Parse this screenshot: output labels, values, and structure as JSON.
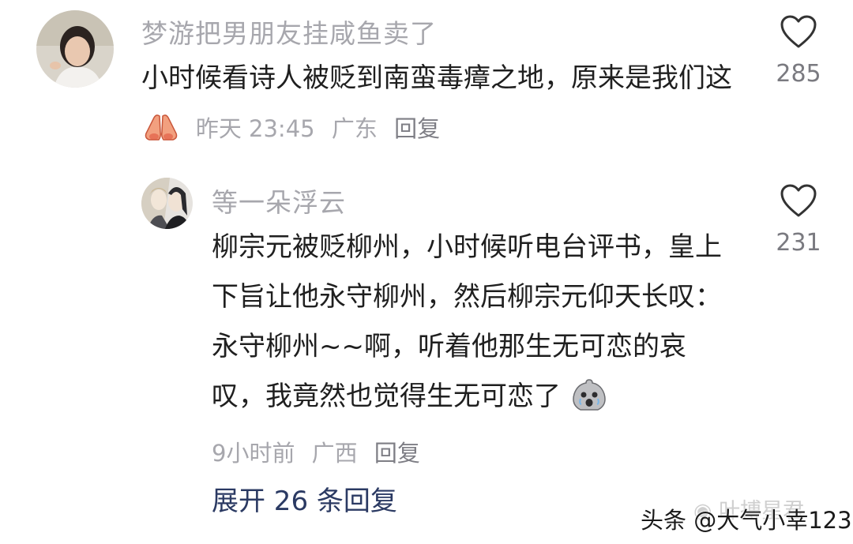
{
  "comments": [
    {
      "username": "梦游把男朋友挂咸鱼卖了",
      "text": "小时候看诗人被贬到南蛮毒瘴之地，原来是我们这",
      "emoji": "praying-hands",
      "time": "昨天 23:45",
      "location": "广东",
      "reply_label": "回复",
      "likes": "285"
    },
    {
      "username": "等一朵浮云",
      "text": "柳宗元被贬柳州，小时候听电台评书，皇上下旨让他永守柳州，然后柳宗元仰天长叹：永守柳州~~啊，听着他那生无可恋的哀叹，我竟然也觉得生无可恋了",
      "emoji": "crying-face",
      "time": "9小时前",
      "location": "广西",
      "reply_label": "回复",
      "likes": "231"
    }
  ],
  "expand_replies": "展开 26 条回复",
  "watermark": {
    "logo_text": "叶搏星君",
    "site_text": "头条 @大气小幸123"
  },
  "colors": {
    "username": "#a7a7ad",
    "text": "#1f1f1f",
    "link": "#2b3a63"
  }
}
